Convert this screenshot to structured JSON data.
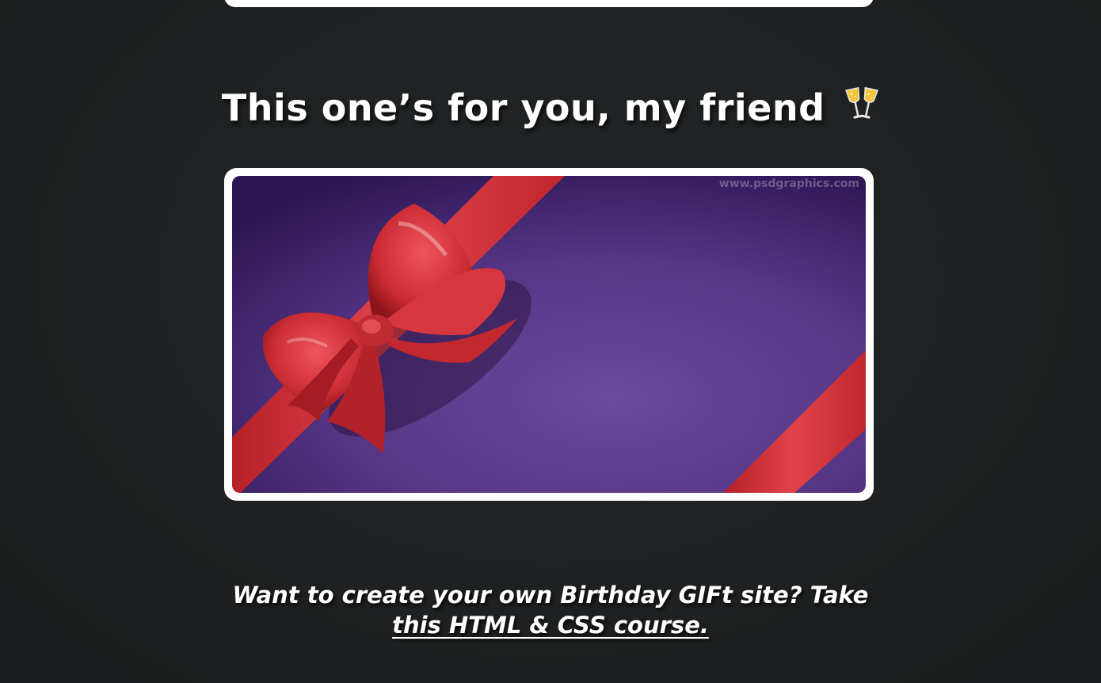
{
  "headline": {
    "text": "This one’s for you, my friend",
    "icon": "champagne-glasses-icon"
  },
  "gift_image": {
    "watermark": "www.psdgraphics.com",
    "colors": {
      "background": "#5a3a8c",
      "ribbon": "#d8363b",
      "frame": "#ffffff"
    }
  },
  "cta": {
    "text": "Want to create your own Birthday GIFt site? Take",
    "link_text": "this HTML & CSS course."
  },
  "colors": {
    "page_background": "#1e2021",
    "text": "#ffffff"
  }
}
